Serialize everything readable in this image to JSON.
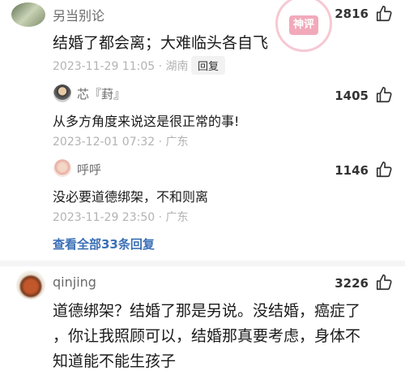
{
  "comments": [
    {
      "user": "另当别论",
      "text": "结婚了都会离；大难临头各自飞",
      "date": "2023-11-29 11:05",
      "location": "湖南",
      "reply_label": "回复",
      "likes": "2816"
    },
    {
      "user": "qinjing",
      "text_lines": [
        "道德绑架？结婚了那是另说。没结婚，癌症了",
        "，你让我照顾可以，结婚那真要考虑，身体不",
        "知道能不能生孩子"
      ],
      "likes": "3226"
    }
  ],
  "replies": [
    {
      "user": "芯『葑』",
      "text": "从多方角度来说这是很正常的事!",
      "date": "2023-12-01 07:32",
      "location": "广东",
      "likes": "1405"
    },
    {
      "user": "呼呼",
      "text": "没必要道德绑架，不和则离",
      "date": "2023-11-29 23:50",
      "location": "广东",
      "likes": "1146"
    }
  ],
  "view_all_replies": "查看全部33条回复",
  "stamp_text": "神评",
  "icons": {
    "like": "thumbs-up-icon"
  },
  "colors": {
    "link": "#3b6fb6",
    "meta": "#b3b3b3",
    "stamp": "#e86282"
  }
}
